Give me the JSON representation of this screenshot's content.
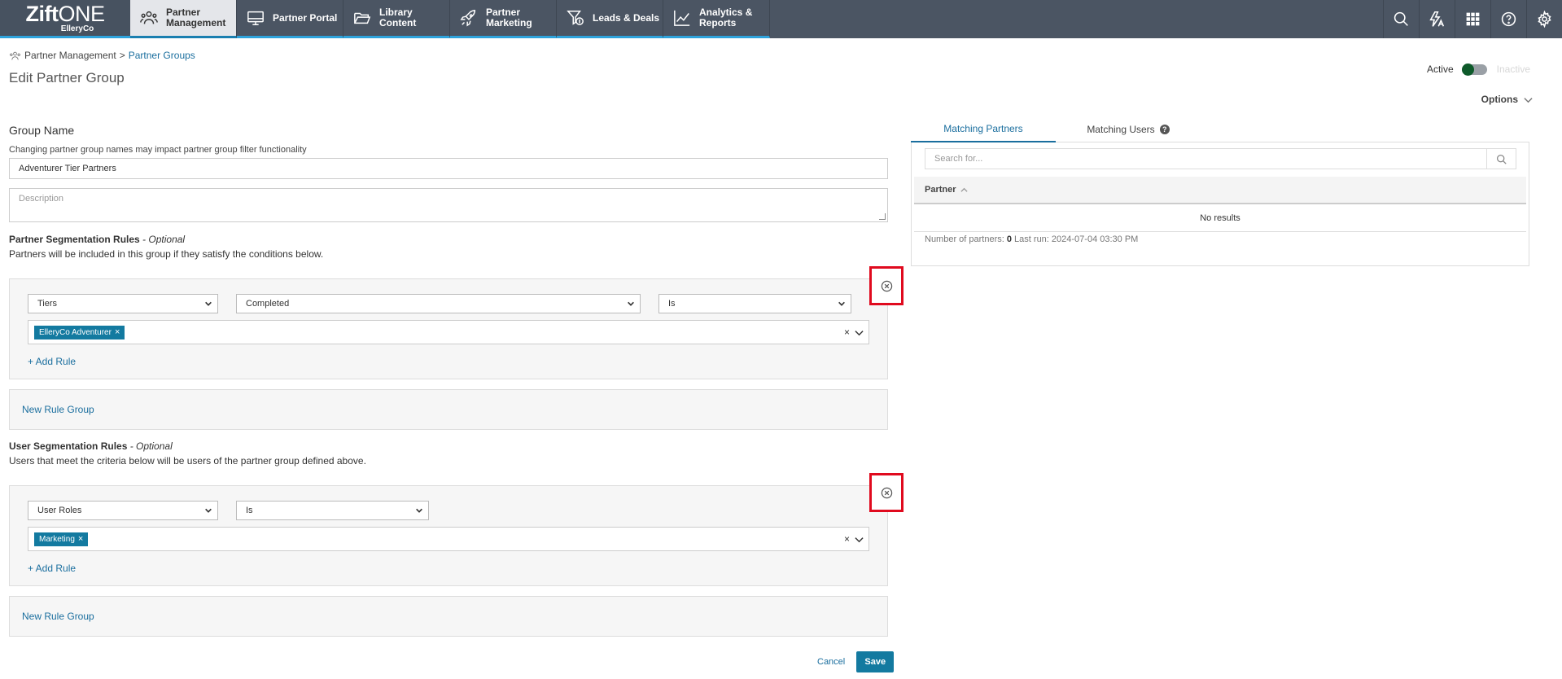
{
  "app": {
    "logo_primary": "Zift",
    "logo_secondary": "ONE",
    "logo_company": "ElleryCo"
  },
  "nav": {
    "items": [
      {
        "label": "Partner Management",
        "icon": "partners-icon",
        "active": true
      },
      {
        "label": "Partner Portal",
        "icon": "monitor-icon",
        "active": false
      },
      {
        "label": "Library Content",
        "icon": "folder-icon",
        "active": false
      },
      {
        "label": "Partner Marketing",
        "icon": "rocket-icon",
        "active": false
      },
      {
        "label": "Leads & Deals",
        "icon": "funnel-dollar-icon",
        "active": false
      },
      {
        "label": "Analytics & Reports",
        "icon": "chart-line-icon",
        "active": false
      }
    ],
    "right_icons": [
      "search-icon",
      "translate-icon",
      "apps-grid-icon",
      "help-icon",
      "gear-icon"
    ]
  },
  "breadcrumb": {
    "root": "Partner Management",
    "separator": ">",
    "current": "Partner Groups"
  },
  "page": {
    "title": "Edit Partner Group",
    "status_active": "Active",
    "status_inactive": "Inactive",
    "options_label": "Options"
  },
  "form": {
    "group_name_heading": "Group Name",
    "group_name_hint": "Changing partner group names may impact partner group filter functionality",
    "group_name_value": "Adventurer Tier Partners",
    "description_placeholder": "Description",
    "partner_rules": {
      "heading": "Partner Segmentation Rules",
      "optional": " - Optional",
      "description": "Partners will be included in this group if they satisfy the conditions below.",
      "field": "Tiers",
      "status": "Completed",
      "operator": "Is",
      "tag": "ElleryCo Adventurer",
      "add_rule": "+ Add Rule",
      "new_group": "New Rule Group"
    },
    "user_rules": {
      "heading": "User Segmentation Rules",
      "optional": " - Optional",
      "description": "Users that meet the criteria below will be users of the partner group defined above.",
      "field": "User Roles",
      "operator": "Is",
      "tag": "Marketing",
      "add_rule": "+ Add Rule",
      "new_group": "New Rule Group"
    },
    "cancel_label": "Cancel",
    "save_label": "Save"
  },
  "right_panel": {
    "tab_partners": "Matching Partners",
    "tab_users": "Matching Users",
    "search_placeholder": "Search for...",
    "column_partner": "Partner",
    "empty_text": "No results",
    "footer_label": "Number of partners: ",
    "footer_count": "0",
    "footer_last_run": " Last run: 2024-07-04 03:30 PM"
  },
  "colors": {
    "nav_bg": "#4b5563",
    "accent": "#137aa0",
    "link": "#1a6e9e",
    "highlight_border": "#e00a1e",
    "toggle_knob": "#0e5a2a"
  }
}
